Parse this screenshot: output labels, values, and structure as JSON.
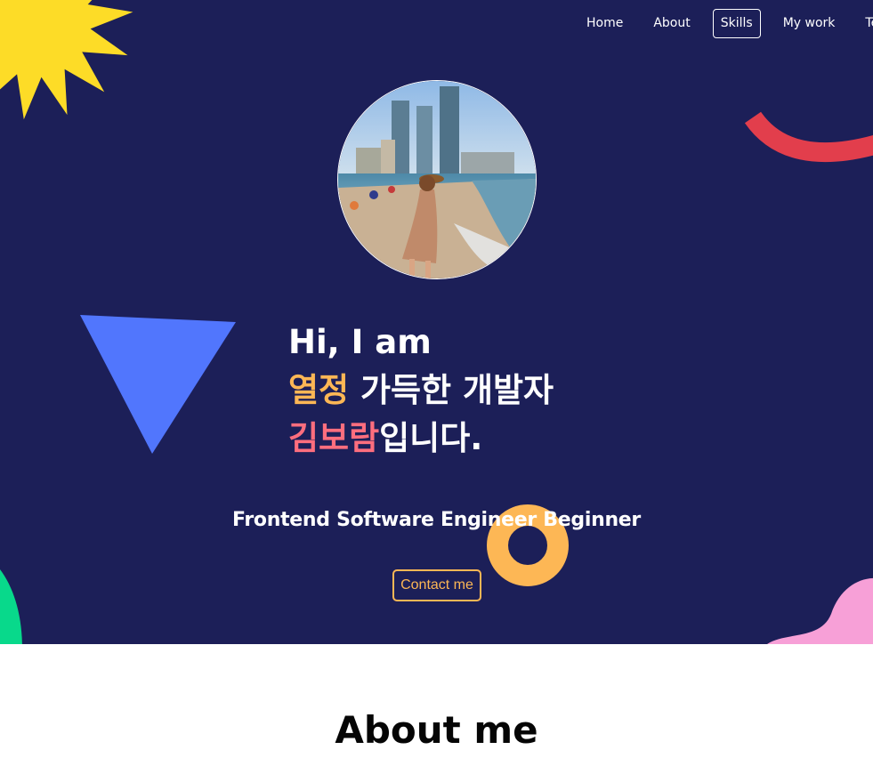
{
  "nav": {
    "items": [
      {
        "label": "Home"
      },
      {
        "label": "About"
      },
      {
        "label": "Skills",
        "active": true
      },
      {
        "label": "My work"
      },
      {
        "label": "Te"
      }
    ]
  },
  "hero": {
    "greeting_line1": "Hi, I am",
    "line2_highlight": "열정",
    "line2_rest": " 가득한 개발자",
    "line3_highlight": "김보람",
    "line3_rest": "입니다.",
    "subtitle": "Frontend Software Engineer Beginner",
    "contact_label": "Contact me",
    "avatar_alt": "profile photo at the beach"
  },
  "about": {
    "title": "About me"
  },
  "colors": {
    "hero_bg": "#1c1f58",
    "accent_orange": "#fdb755",
    "accent_pink": "#fe6e7e",
    "sun_yellow": "#fddc27",
    "arc_red": "#e23e4c",
    "triangle_blue": "#5176fd",
    "green": "#08d98b",
    "pink_blob": "#f7a0d7"
  },
  "icons": [
    "sun-shape",
    "red-arc-shape",
    "blue-triangle-shape",
    "orange-donut-shape",
    "green-blob-shape",
    "pink-blob-shape"
  ]
}
